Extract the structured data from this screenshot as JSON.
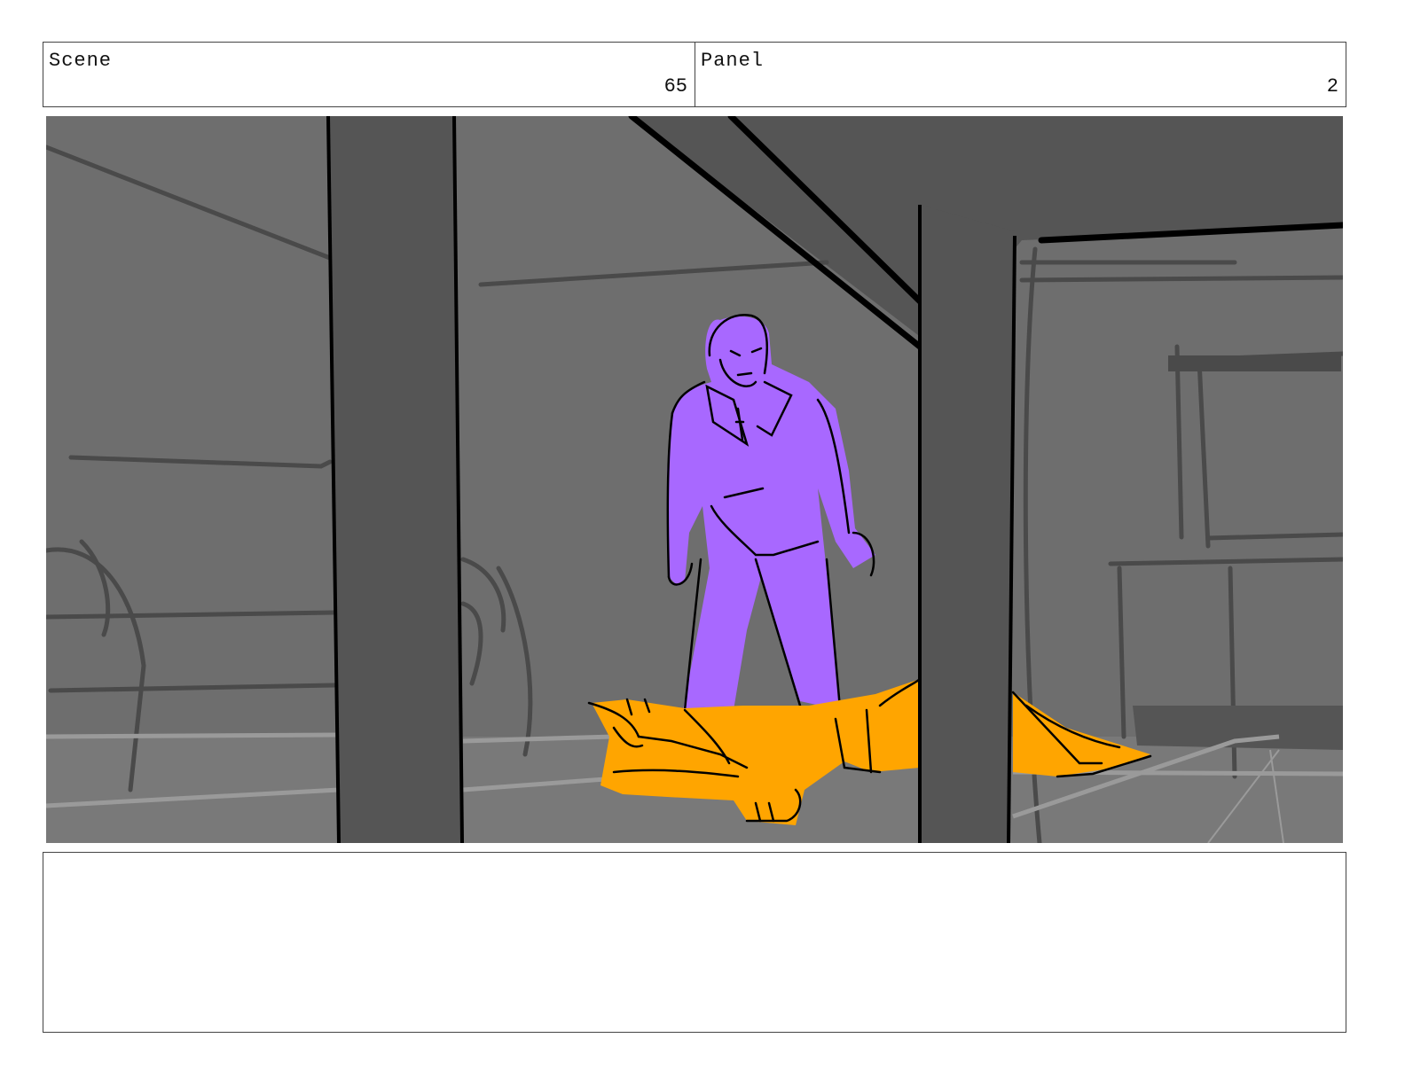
{
  "header": {
    "scene_label": "Scene",
    "scene_number": "65",
    "panel_label": "Panel",
    "panel_number": "2"
  },
  "frame": {
    "colors": {
      "background": "#6e6e6e",
      "pillar": "#555555",
      "standing_figure": "#a868ff",
      "lying_figure": "#ffa500",
      "ink": "#000000"
    }
  },
  "notes": {
    "text": ""
  }
}
